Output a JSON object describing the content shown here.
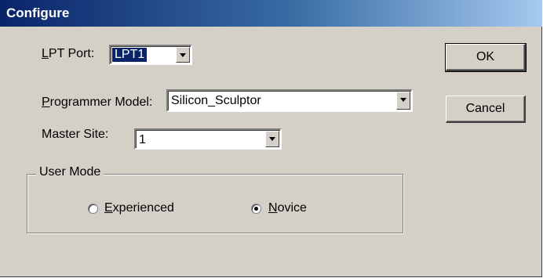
{
  "dialog": {
    "title": "Configure"
  },
  "lpt_port": {
    "label_prefix": "",
    "label_accel": "L",
    "label_rest": "PT Port:",
    "value": "LPT1"
  },
  "programmer_model": {
    "label_accel": "P",
    "label_rest": "rogrammer Model:",
    "value": "Silicon_Sculptor"
  },
  "master_site": {
    "label": "Master Site:",
    "value": "1"
  },
  "user_mode": {
    "legend": "User Mode",
    "options": [
      {
        "accel": "E",
        "rest": "xperienced",
        "selected": false
      },
      {
        "accel": "N",
        "rest": "ovice",
        "selected": true
      }
    ]
  },
  "buttons": {
    "ok": "OK",
    "cancel": "Cancel"
  }
}
